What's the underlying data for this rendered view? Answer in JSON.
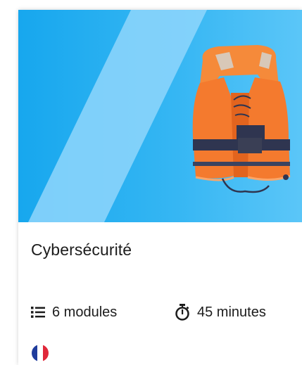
{
  "card": {
    "image": {
      "subject": "life-jacket-icon",
      "colors": {
        "background": "#2ab0f0",
        "stripe": "#8fd6fb",
        "vest": "#f47a2e",
        "strap": "#2f3550"
      }
    },
    "title": "Cybersécurité",
    "modules": {
      "icon": "list-icon",
      "label": "6 modules"
    },
    "duration": {
      "icon": "stopwatch-icon",
      "label": "45 minutes"
    },
    "language": {
      "icon": "france-flag-icon",
      "colors": [
        "#1f3c9c",
        "#ffffff",
        "#e0283a"
      ]
    }
  }
}
